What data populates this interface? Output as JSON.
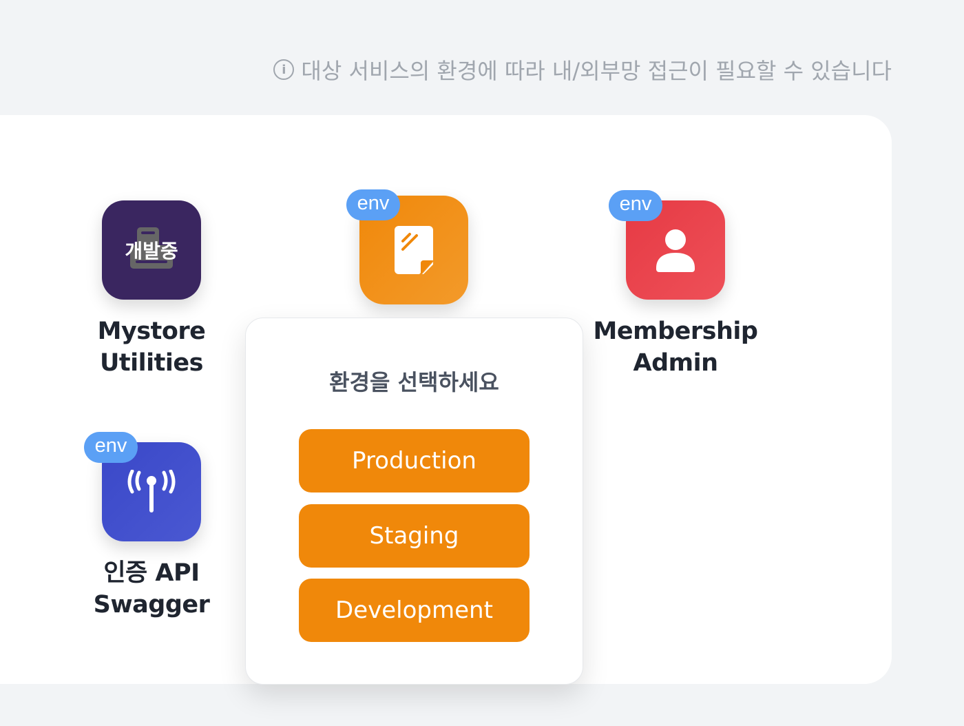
{
  "info": {
    "icon": "info-circle-icon",
    "text": "대상 서비스의 환경에 따라 내/외부망 접근이 필요할 수 있습니다"
  },
  "apps": [
    {
      "name": "Mystore Utilities",
      "line1": "Mystore",
      "line2": "Utilities",
      "overlay": "개발중",
      "color": "#3a2660",
      "icon": "cash-register-icon",
      "env": false
    },
    {
      "color": "#f0880a",
      "icon": "document-icon",
      "env": true,
      "env_label": "env"
    },
    {
      "name": "Membership Admin",
      "line1": "Membership",
      "line2": "Admin",
      "color": "#e8404a",
      "icon": "user-icon",
      "env": true,
      "env_label": "env"
    },
    {
      "name": "인증 API Swagger",
      "line1": "인증 API",
      "line2": "Swagger",
      "color": "#3d4ccc",
      "icon": "antenna-icon",
      "env": true,
      "env_label": "env"
    }
  ],
  "popup": {
    "title": "환경을 선택하세요",
    "options": [
      "Production",
      "Staging",
      "Development"
    ],
    "accent": "#f0880a"
  }
}
